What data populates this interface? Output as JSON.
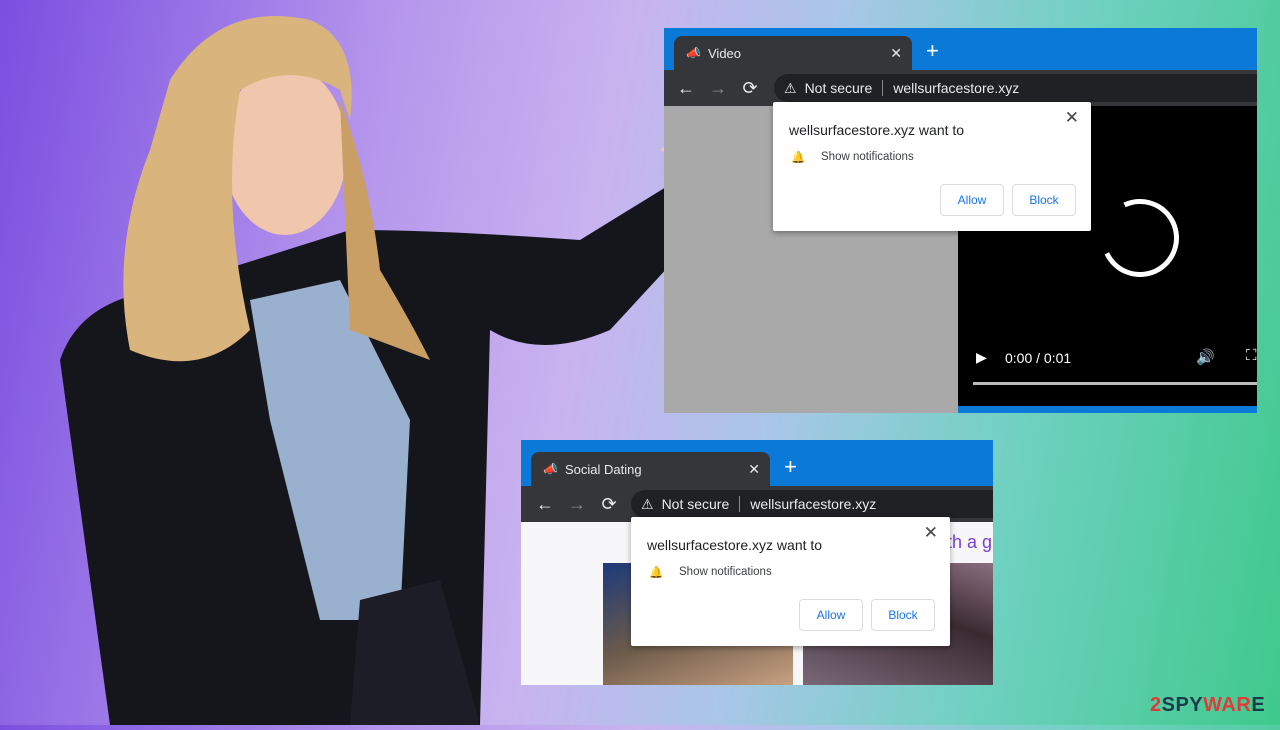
{
  "windows": [
    {
      "tab_title": "Video",
      "security": "Not secure",
      "url": "wellsurfacestore.xyz",
      "popup": {
        "title": "wellsurfacestore.xyz want to",
        "permission": "Show notifications",
        "allow": "Allow",
        "block": "Block"
      },
      "video": {
        "time": "0:00 / 0:01",
        "progress": 0
      }
    },
    {
      "tab_title": "Social Dating",
      "security": "Not secure",
      "url": "wellsurfacestore.xyz",
      "popup": {
        "title": "wellsurfacestore.xyz want to",
        "permission": "Show notifications",
        "allow": "Allow",
        "block": "Block"
      },
      "page_text_fragment": "th a g"
    }
  ],
  "logo": {
    "text": "2SPYWARE",
    "colors": {
      "red": "#e03a3a",
      "dark": "#1d3a4a"
    }
  },
  "colors": {
    "tab_bar": "#0b79d8",
    "toolbar": "#35363a",
    "link": "#1a73e8"
  }
}
